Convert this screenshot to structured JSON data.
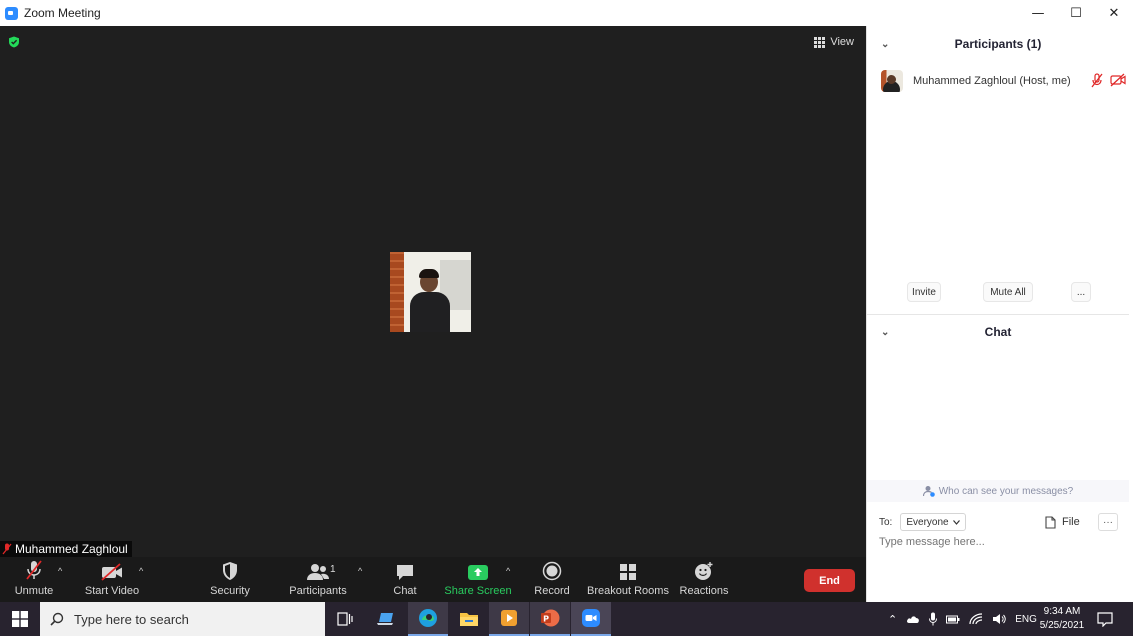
{
  "window": {
    "title": "Zoom Meeting",
    "controls": {
      "minimize": "—",
      "maximize": "☐",
      "close": "✕"
    }
  },
  "video": {
    "view_label": "View",
    "participant_name": "Muhammed Zaghloul"
  },
  "toolbar": {
    "unmute": "Unmute",
    "start_video": "Start Video",
    "security": "Security",
    "participants": "Participants",
    "participants_count": "1",
    "chat": "Chat",
    "share_screen": "Share Screen",
    "record": "Record",
    "breakout_rooms": "Breakout Rooms",
    "reactions": "Reactions",
    "end": "End",
    "caret": "^"
  },
  "participants_panel": {
    "title": "Participants (1)",
    "list": [
      {
        "name": "Muhammed Zaghloul (Host, me)",
        "muted": true,
        "video_off": true
      }
    ],
    "invite": "Invite",
    "mute_all": "Mute All",
    "more": "..."
  },
  "chat_panel": {
    "title": "Chat",
    "who_can_see": "Who can see your messages?",
    "to_label": "To:",
    "recipient": "Everyone",
    "file": "File",
    "more": "···",
    "placeholder": "Type message here..."
  },
  "taskbar": {
    "search_placeholder": "Type here to search",
    "language": "ENG",
    "time": "9:34 AM",
    "date": "5/25/2021"
  },
  "colors": {
    "accent_blue": "#2d8cff",
    "share_green": "#29cc5f",
    "end_red": "#d0312d",
    "mute_red": "#e02828",
    "secure_green": "#23d959"
  }
}
